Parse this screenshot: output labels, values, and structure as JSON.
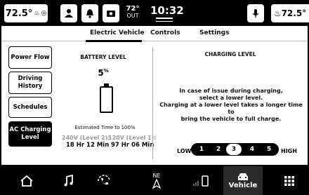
{
  "status_bar": {
    "temp_left": "72.5°",
    "temp_right": "72.5°",
    "outside_temp": "72°",
    "outside_label": "OUT",
    "clock": "10:32"
  },
  "tabs": [
    {
      "label": "Electric Vehicle",
      "active": true
    },
    {
      "label": "Controls",
      "active": false
    },
    {
      "label": "Settings",
      "active": false
    }
  ],
  "sidebar": [
    {
      "label": "Power Flow",
      "active": false
    },
    {
      "label": "Driving History",
      "active": false
    },
    {
      "label": "Schedules",
      "active": false
    },
    {
      "label": "AC Charging Level",
      "active": true
    }
  ],
  "battery": {
    "title": "BATTERY LEVEL",
    "percent": "5",
    "percent_unit": "%",
    "level_fraction": 0.05,
    "estimated_label": "Estimated Time to 100%",
    "level2_label": "240V (Level 2):",
    "level1_label": "120V (Level 1):",
    "level2_time": "18 Hr 12 Min",
    "level1_time": "97 Hr 06 Min"
  },
  "charging": {
    "title": "CHARGING LEVEL",
    "message_line1": "In case of issue during charging,",
    "message_line2": "select a lower level.",
    "message_line3": "Charging at a lower level takes a longer time to",
    "message_line4": "bring the vehicle to full charge.",
    "low_label": "LOW",
    "high_label": "HIGH",
    "levels": [
      "1",
      "2",
      "3",
      "4",
      "5"
    ],
    "selected_level": 3
  },
  "nav": {
    "compass": "NE",
    "vehicle_label": "Vehicle"
  },
  "icons": [
    "seat-heat-icon",
    "steering-heat-icon",
    "person-icon",
    "bell-icon",
    "camera-icon",
    "mic-icon",
    "home-icon",
    "music-icon",
    "phone-icon",
    "compass-icon",
    "signal-icon",
    "vehicle-icon",
    "apps-icon"
  ]
}
